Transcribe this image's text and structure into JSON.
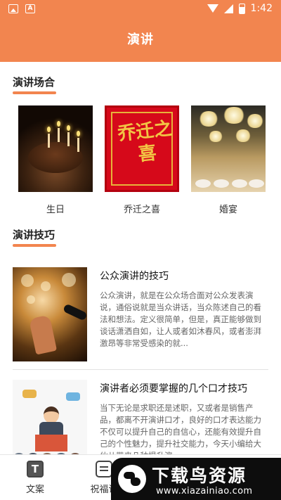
{
  "status_bar": {
    "time": "1:42"
  },
  "app_bar": {
    "title": "演讲"
  },
  "occasions_section": {
    "title": "演讲场合",
    "items": [
      {
        "label": "生日"
      },
      {
        "label": "乔迁之喜",
        "image_text": "乔迁之喜"
      },
      {
        "label": "婚宴"
      }
    ]
  },
  "tips_section": {
    "title": "演讲技巧",
    "articles": [
      {
        "title": "公众演讲的技巧",
        "summary": "公众演讲，就是在公众场合面对公众发表演说，通俗说就是当众讲话，当众陈述自己的看法和想法。定义很简单，但是，真正能够做到谈话潇洒自如，让人或者如沐春风，或者澎湃激昂等非常受感染的就..."
      },
      {
        "title": "演讲者必须要掌握的几个口才技巧",
        "summary": "当下无论是求职还是述职，又或者是销售产品，都离不开演讲口才，良好的口才表达能力不仅可以提升自己的自信心，还能有效提升自己的个性魅力，提升社交能力，今天小编给大伙儿带来几种提升演..."
      }
    ]
  },
  "bottom_nav": {
    "items": [
      {
        "label": "文案",
        "icon": "text-document-icon"
      },
      {
        "label": "祝福语",
        "icon": "chat-icon"
      }
    ]
  },
  "watermark": {
    "title": "下载鸟资源",
    "url": "www.xiazainiao.com"
  },
  "colors": {
    "accent": "#f2854f",
    "background": "#ffffff"
  }
}
